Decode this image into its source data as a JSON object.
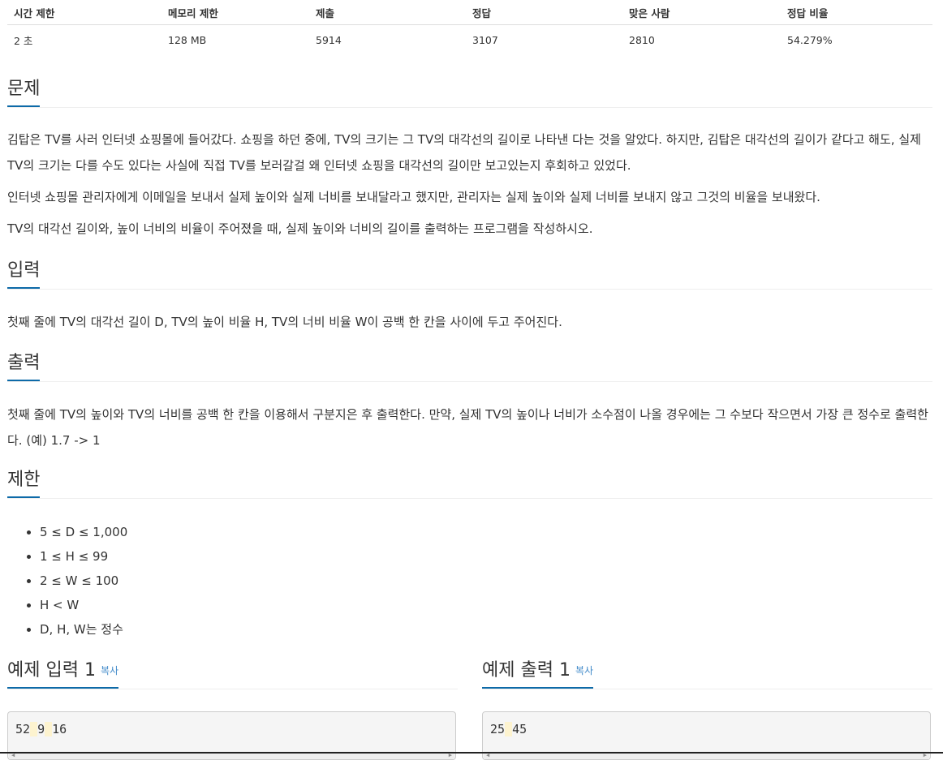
{
  "stats": {
    "headers": [
      "시간 제한",
      "메모리 제한",
      "제출",
      "정답",
      "맞은 사람",
      "정답 비율"
    ],
    "values": [
      "2 초",
      "128 MB",
      "5914",
      "3107",
      "2810",
      "54.279%"
    ]
  },
  "problem": {
    "title": "문제",
    "paragraphs": [
      "김탑은 TV를 사러 인터넷 쇼핑몰에 들어갔다. 쇼핑을 하던 중에, TV의 크기는 그 TV의 대각선의 길이로 나타낸 다는 것을 알았다. 하지만, 김탑은 대각선의 길이가 같다고 해도, 실제 TV의 크기는 다를 수도 있다는 사실에 직접 TV를 보러갈걸 왜 인터넷 쇼핑을 대각선의 길이만 보고있는지 후회하고 있었다.",
      "인터넷 쇼핑몰 관리자에게 이메일을 보내서 실제 높이와 실제 너비를 보내달라고 했지만, 관리자는 실제 높이와 실제 너비를 보내지 않고 그것의 비율을 보내왔다.",
      "TV의 대각선 길이와, 높이 너비의 비율이 주어졌을 때, 실제 높이와 너비의 길이를 출력하는 프로그램을 작성하시오."
    ]
  },
  "input": {
    "title": "입력",
    "text": "첫째 줄에 TV의 대각선 길이 D, TV의 높이 비율 H, TV의 너비 비율 W이 공백 한 칸을 사이에 두고 주어진다."
  },
  "output": {
    "title": "출력",
    "text": "첫째 줄에 TV의 높이와 TV의 너비를 공백 한 칸을 이용해서 구분지은 후 출력한다. 만약, 실제 TV의 높이나 너비가 소수점이 나올 경우에는 그 수보다 작으면서 가장 큰 정수로 출력한다. (예) 1.7 -> 1"
  },
  "limit": {
    "title": "제한",
    "items": [
      "5 ≤ D ≤ 1,000",
      "1 ≤ H ≤ 99",
      "2 ≤ W ≤ 100",
      "H < W",
      "D, H, W는 정수"
    ]
  },
  "sample_input": {
    "title": "예제 입력 1",
    "copy_label": "복사",
    "tokens": [
      "52",
      "9",
      "16"
    ]
  },
  "sample_output": {
    "title": "예제 출력 1",
    "copy_label": "복사",
    "tokens": [
      "25",
      "45"
    ]
  },
  "colors": {
    "heading_underline": "#0d6aa8",
    "copy_link": "#428bca",
    "code_background": "#f5f5f5",
    "whitespace_highlight": "#fdf3cf"
  }
}
